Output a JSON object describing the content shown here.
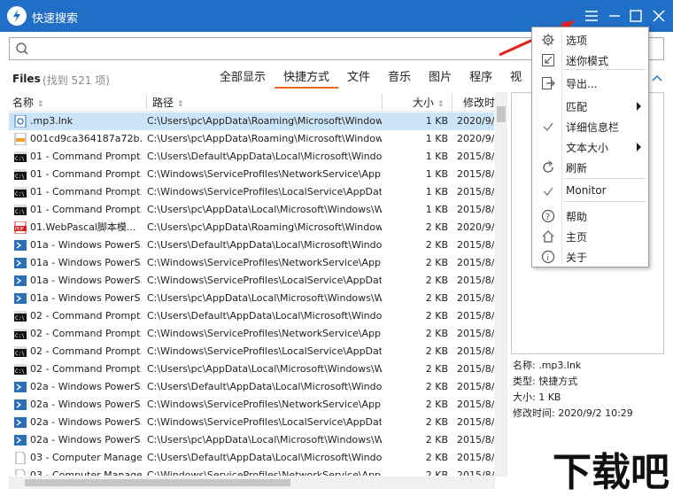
{
  "window": {
    "title": "快速搜索"
  },
  "search": {
    "placeholder": ""
  },
  "files": {
    "label": "Files",
    "count": "(找到 521 项)"
  },
  "tabs": [
    {
      "label": "全部显示",
      "active": false
    },
    {
      "label": "快捷方式",
      "active": true
    },
    {
      "label": "文件",
      "active": false
    },
    {
      "label": "音乐",
      "active": false
    },
    {
      "label": "图片",
      "active": false
    },
    {
      "label": "程序",
      "active": false
    },
    {
      "label": "视",
      "active": false
    }
  ],
  "columns": {
    "name": "名称",
    "path": "路径",
    "size": "大小",
    "modified": "修改时"
  },
  "rows": [
    {
      "icon": "shortcut-icon",
      "name": ".mp3.lnk",
      "path": "C:\\Users\\pc\\AppData\\Roaming\\Microsoft\\Windows\\...",
      "size": "1 KB",
      "date": "2020/9/",
      "selected": true
    },
    {
      "icon": "image-file-icon",
      "name": "001cd9ca364187a72b...",
      "path": "C:\\Users\\pc\\AppData\\Roaming\\Microsoft\\Windows\\...",
      "size": "1 KB",
      "date": "2020/9/"
    },
    {
      "icon": "cmd-icon",
      "name": "01 - Command Prompt.lnk",
      "path": "C:\\Users\\Default\\AppData\\Local\\Microsoft\\Window...",
      "size": "1 KB",
      "date": "2015/8/"
    },
    {
      "icon": "cmd-icon",
      "name": "01 - Command Prompt.lnk",
      "path": "C:\\Windows\\ServiceProfiles\\NetworkService\\AppDa...",
      "size": "1 KB",
      "date": "2015/8/"
    },
    {
      "icon": "cmd-icon",
      "name": "01 - Command Prompt.lnk",
      "path": "C:\\Windows\\ServiceProfiles\\LocalService\\AppData\\...",
      "size": "1 KB",
      "date": "2015/8/"
    },
    {
      "icon": "cmd-icon",
      "name": "01 - Command Prompt.lnk",
      "path": "C:\\Users\\pc\\AppData\\Local\\Microsoft\\Windows\\Win...",
      "size": "1 KB",
      "date": "2015/8/"
    },
    {
      "icon": "pdf-icon",
      "name": "01.WebPascal脚本模...",
      "path": "C:\\Users\\pc\\AppData\\Roaming\\Microsoft\\Windows\\...",
      "size": "2 KB",
      "date": "2020/9/"
    },
    {
      "icon": "powershell-icon",
      "name": "01a - Windows PowerS...",
      "path": "C:\\Users\\Default\\AppData\\Local\\Microsoft\\Window...",
      "size": "2 KB",
      "date": "2015/8/"
    },
    {
      "icon": "powershell-icon",
      "name": "01a - Windows PowerS...",
      "path": "C:\\Windows\\ServiceProfiles\\NetworkService\\AppDa...",
      "size": "2 KB",
      "date": "2015/8/"
    },
    {
      "icon": "powershell-icon",
      "name": "01a - Windows PowerS...",
      "path": "C:\\Windows\\ServiceProfiles\\LocalService\\AppData\\...",
      "size": "2 KB",
      "date": "2015/8/"
    },
    {
      "icon": "powershell-icon",
      "name": "01a - Windows PowerS...",
      "path": "C:\\Users\\pc\\AppData\\Local\\Microsoft\\Windows\\Win...",
      "size": "2 KB",
      "date": "2015/8/"
    },
    {
      "icon": "cmd-icon",
      "name": "02 - Command Prompt.lnk",
      "path": "C:\\Users\\Default\\AppData\\Local\\Microsoft\\Window...",
      "size": "2 KB",
      "date": "2015/8/"
    },
    {
      "icon": "cmd-icon",
      "name": "02 - Command Prompt.lnk",
      "path": "C:\\Windows\\ServiceProfiles\\NetworkService\\AppDa...",
      "size": "2 KB",
      "date": "2015/8/"
    },
    {
      "icon": "cmd-icon",
      "name": "02 - Command Prompt.lnk",
      "path": "C:\\Windows\\ServiceProfiles\\LocalService\\AppData\\...",
      "size": "2 KB",
      "date": "2015/8/"
    },
    {
      "icon": "cmd-icon",
      "name": "02 - Command Prompt.lnk",
      "path": "C:\\Users\\pc\\AppData\\Local\\Microsoft\\Windows\\Win...",
      "size": "2 KB",
      "date": "2015/8/"
    },
    {
      "icon": "powershell-icon",
      "name": "02a - Windows PowerS...",
      "path": "C:\\Users\\Default\\AppData\\Local\\Microsoft\\Window...",
      "size": "2 KB",
      "date": "2015/8/"
    },
    {
      "icon": "powershell-icon",
      "name": "02a - Windows PowerS...",
      "path": "C:\\Windows\\ServiceProfiles\\NetworkService\\AppDa...",
      "size": "2 KB",
      "date": "2015/8/"
    },
    {
      "icon": "powershell-icon",
      "name": "02a - Windows PowerS...",
      "path": "C:\\Windows\\ServiceProfiles\\LocalService\\AppData\\...",
      "size": "2 KB",
      "date": "2015/8/"
    },
    {
      "icon": "powershell-icon",
      "name": "02a - Windows PowerS...",
      "path": "C:\\Users\\pc\\AppData\\Local\\Microsoft\\Windows\\Win...",
      "size": "2 KB",
      "date": "2015/8/"
    },
    {
      "icon": "blank-file-icon",
      "name": "03 - Computer Manage...",
      "path": "C:\\Users\\Default\\AppData\\Local\\Microsoft\\Window...",
      "size": "2 KB",
      "date": "2015/8/"
    },
    {
      "icon": "blank-file-icon",
      "name": "03 - Computer Manage...",
      "path": "C:\\Windows\\ServiceProfiles\\NetworkService\\AppDa...",
      "size": "2 KB",
      "date": "2015/8/"
    }
  ],
  "menu": [
    {
      "label": "选项",
      "icon": "gear-icon"
    },
    {
      "label": "迷你模式",
      "icon": "mini-mode-icon"
    },
    {
      "label": "导出...",
      "icon": "export-icon"
    },
    {
      "label": "匹配",
      "icon": "",
      "submenu": true
    },
    {
      "label": "详细信息栏",
      "icon": "check-icon"
    },
    {
      "label": "文本大小",
      "icon": "",
      "submenu": true
    },
    {
      "label": "刷新",
      "icon": "refresh-icon"
    },
    {
      "label": "Monitor",
      "icon": "check-icon"
    },
    {
      "label": "帮助",
      "icon": "help-icon"
    },
    {
      "label": "主页",
      "icon": "home-icon"
    },
    {
      "label": "关于",
      "icon": "info-icon"
    }
  ],
  "details": {
    "name": "名称: .mp3.lnk",
    "type": "类型: 快捷方式",
    "size": "大小: 1 KB",
    "modified": "修改时间: 2020/9/2 10:29"
  },
  "watermark": {
    "text": "下载吧"
  },
  "colors": {
    "titlebar": "#1f6fc6",
    "active_tab": "#e86b1c",
    "selected_row": "#cce4f7",
    "arrow": "#e02020"
  }
}
